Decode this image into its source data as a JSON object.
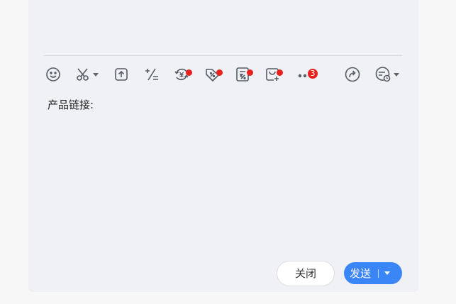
{
  "colors": {
    "panel_bg": "#f0f1f5",
    "icon": "#555a63",
    "badge": "#e8211c",
    "send_button": "#3a86f7"
  },
  "toolbar": {
    "items": [
      {
        "icon": "emoji-icon"
      },
      {
        "icon": "scissors-icon",
        "has_dropdown": true
      },
      {
        "icon": "upload-icon"
      },
      {
        "icon": "calculator-icon"
      },
      {
        "icon": "yuan-exchange-icon",
        "has_dot": true
      },
      {
        "icon": "discount-tag-icon",
        "has_dot": true
      },
      {
        "icon": "receipt-icon",
        "has_dot": true
      },
      {
        "icon": "add-bag-icon",
        "has_dot": true
      },
      {
        "icon": "more-icon",
        "badge": "3"
      },
      {
        "icon": "share-icon"
      },
      {
        "icon": "scheduled-message-icon",
        "has_dropdown": true
      }
    ]
  },
  "editor": {
    "label": "产品链接:"
  },
  "buttons": {
    "close": "关闭",
    "send": "发送"
  }
}
